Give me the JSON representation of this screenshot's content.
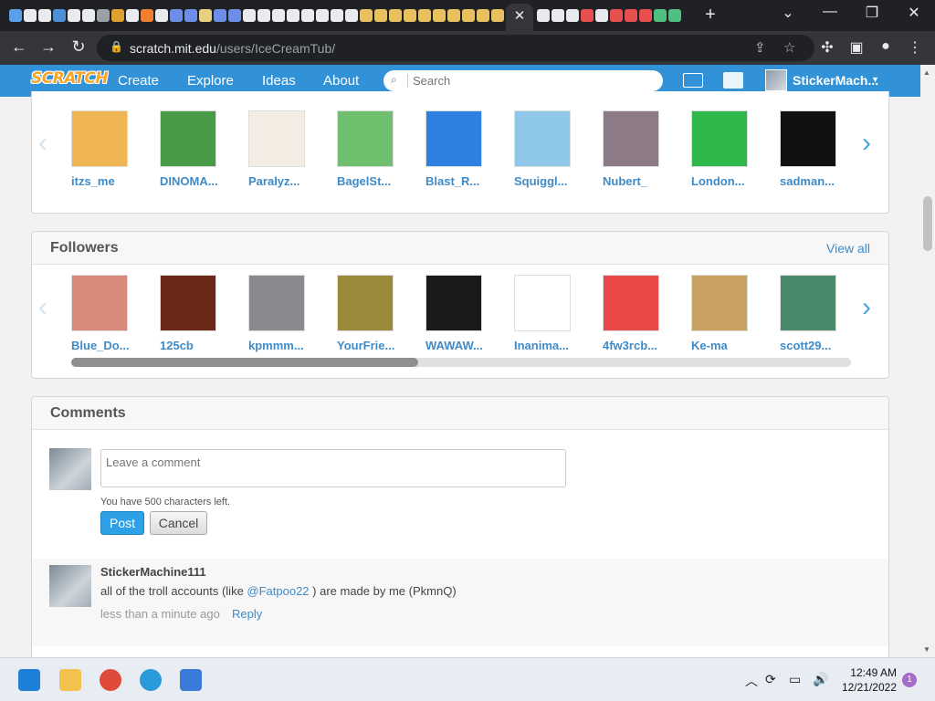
{
  "browser": {
    "tab_favicons": [
      "#5aa0e8",
      "#e8eaed",
      "#e8eaed",
      "#4f8fd6",
      "#e8eaed",
      "#e8eaed",
      "#9aa0a6",
      "#e0a030",
      "#e8eaed",
      "#f08030",
      "#e8eaed",
      "#6c8ee8",
      "#6c8ee8",
      "#e8d080",
      "#6c8ee8",
      "#6c8ee8",
      "#e8eaed",
      "#e8eaed",
      "#e8eaed",
      "#e8eaed",
      "#e8eaed",
      "#e8eaed",
      "#e8eaed",
      "#e8eaed",
      "#e8c060",
      "#e8c060",
      "#e8c060",
      "#e8c060",
      "#e8c060",
      "#e8c060",
      "#e8c060",
      "#e8c060",
      "#e8c060",
      "#e8c060"
    ],
    "right_favicons": [
      "#e8eaed",
      "#e8eaed",
      "#e8eaed",
      "#e85050",
      "#e8eaed",
      "#e85050",
      "#e85050",
      "#e85050",
      "#50c080",
      "#50c080"
    ],
    "tab_close": "✕",
    "new_tab": "+",
    "url_host": "scratch.mit.edu",
    "url_path": "/users/IceCreamTub/"
  },
  "scratch_nav": {
    "logo": "SCRATCH",
    "links": [
      "Create",
      "Explore",
      "Ideas",
      "About"
    ],
    "search_placeholder": "Search",
    "username": "StickerMach..."
  },
  "following": {
    "items": [
      {
        "name": "itzs_me",
        "color": "#f2b554"
      },
      {
        "name": "DINOMA...",
        "color": "#4a9a4a"
      },
      {
        "name": "Paralyz...",
        "color": "#f3ece3"
      },
      {
        "name": "BagelSt...",
        "color": "#6fbf6f"
      },
      {
        "name": "Blast_R...",
        "color": "#2f7fe0"
      },
      {
        "name": "Squiggl...",
        "color": "#8fc7e8"
      },
      {
        "name": "Nubert_",
        "color": "#8c7a86"
      },
      {
        "name": "London...",
        "color": "#2eb84a"
      },
      {
        "name": "sadman...",
        "color": "#111111"
      }
    ]
  },
  "followers": {
    "title": "Followers",
    "view_all": "View all",
    "items": [
      {
        "name": "Blue_Do...",
        "color": "#d98a7a"
      },
      {
        "name": "125cb",
        "color": "#6a2a1a"
      },
      {
        "name": "kpmmm...",
        "color": "#8a8a8e"
      },
      {
        "name": "YourFrie...",
        "color": "#9a8a3a"
      },
      {
        "name": "WAWAW...",
        "color": "#1a1a1a"
      },
      {
        "name": "Inanima...",
        "color": "#ffffff"
      },
      {
        "name": "4fw3rcb...",
        "color": "#e84848"
      },
      {
        "name": "Ke-ma",
        "color": "#c8a060"
      },
      {
        "name": "scott29...",
        "color": "#4a8a6a"
      }
    ]
  },
  "comments": {
    "title": "Comments",
    "placeholder": "Leave a comment",
    "char_limit": "You have 500 characters left.",
    "post": "Post",
    "cancel": "Cancel",
    "list": [
      {
        "user": "StickerMachine111",
        "text_before": "all of the troll accounts (like ",
        "mention": "@Fatpoo22",
        "text_after": " ) are made by me (PkmnQ)",
        "time": "less than a minute ago",
        "reply": "Reply"
      }
    ]
  },
  "taskbar": {
    "apps": [
      {
        "name": "start",
        "color": "#1e7fd8"
      },
      {
        "name": "file-explorer",
        "color": "#f2c14e"
      },
      {
        "name": "chrome",
        "color": "#e04a3a"
      },
      {
        "name": "edge",
        "color": "#2a9ad8"
      },
      {
        "name": "store",
        "color": "#3a7ad8"
      }
    ],
    "time": "12:49 AM",
    "date": "12/21/2022",
    "notifications": "1"
  }
}
